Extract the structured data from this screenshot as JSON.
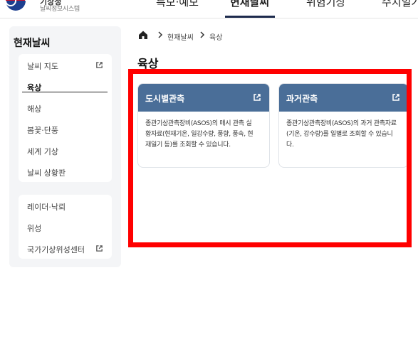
{
  "header": {
    "logo_title": "기상청",
    "logo_subtitle": "날씨정보시스템",
    "nav": [
      {
        "label": "특보·예보"
      },
      {
        "label": "현재날씨",
        "active": true
      },
      {
        "label": "위험기상"
      },
      {
        "label": "수치일기도"
      }
    ]
  },
  "sidebar": {
    "title": "현재날씨",
    "group1": [
      {
        "label": "날씨 지도",
        "external": true
      },
      {
        "label": "육상",
        "active": true
      },
      {
        "label": "해상"
      },
      {
        "label": "봄꽃·단풍"
      },
      {
        "label": "세계 기상"
      },
      {
        "label": "날씨 상황판"
      }
    ],
    "group2": [
      {
        "label": "레이더·낙뢰"
      },
      {
        "label": "위성"
      },
      {
        "label": "국가기상위성센터",
        "external": true
      }
    ]
  },
  "breadcrumb": {
    "items": [
      "현재날씨",
      "육상"
    ]
  },
  "main": {
    "title": "육상",
    "cards": [
      {
        "title": "도시별관측",
        "desc_lines": [
          "종관기상관측장비(ASOS)의 매시 관측 실",
          "황자료(현재기온, 일강수량, 풍향, 풍속, 현",
          "재일기 등)를 조회할 수 있습니다."
        ]
      },
      {
        "title": "과거관측",
        "desc_lines": [
          "종관기상관측장비(ASOS)의 과거 관측자료",
          "(기온, 강수량)를 일별로 조회할 수 있습니",
          "다."
        ]
      }
    ]
  },
  "colors": {
    "card_header": "#4a6e98",
    "highlight": "#ff0000",
    "nav_active_underline": "#1d2a4d",
    "sidebar_bg": "#f4f5f7"
  }
}
